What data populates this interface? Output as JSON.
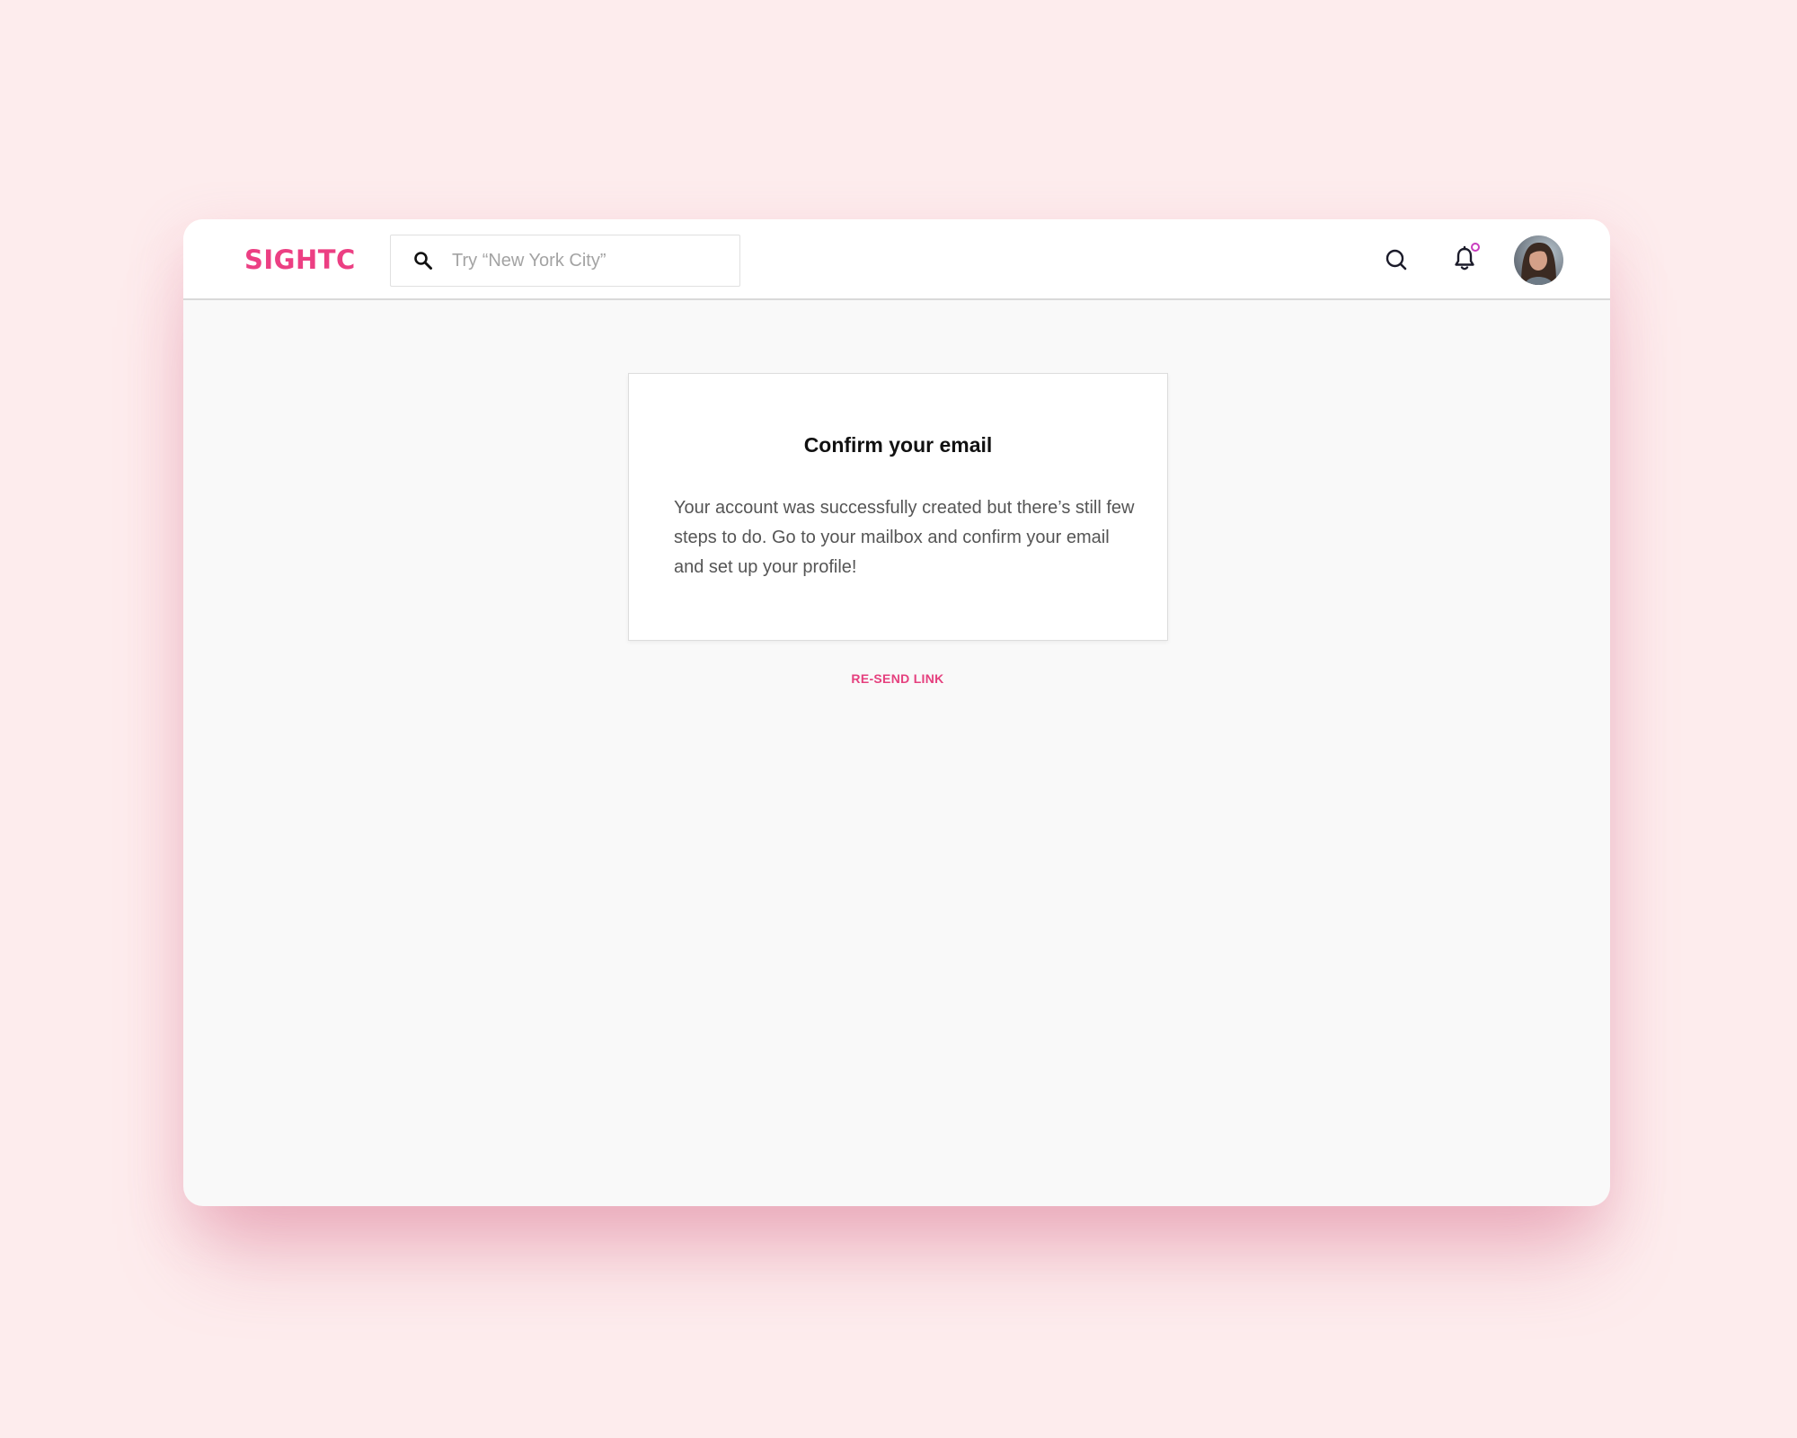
{
  "header": {
    "logo_text": "SIGHTC",
    "search": {
      "placeholder": "Try “New York City”",
      "value": ""
    },
    "notification_has_unread": true
  },
  "confirm_card": {
    "title": "Confirm your email",
    "message": "Your account was successfully created but there’s  still few steps to do. Go to your mailbox and confirm your email and set up your profile!"
  },
  "actions": {
    "resend_label": "RE-SEND LINK"
  },
  "icons": {
    "search_field": "search-icon",
    "header_search": "search-icon",
    "notifications": "bell-icon"
  },
  "colors": {
    "brand": "#ec3f83",
    "link": "#e5407e",
    "notification_dot": "#c83dbe",
    "page_background": "#fdeced"
  }
}
